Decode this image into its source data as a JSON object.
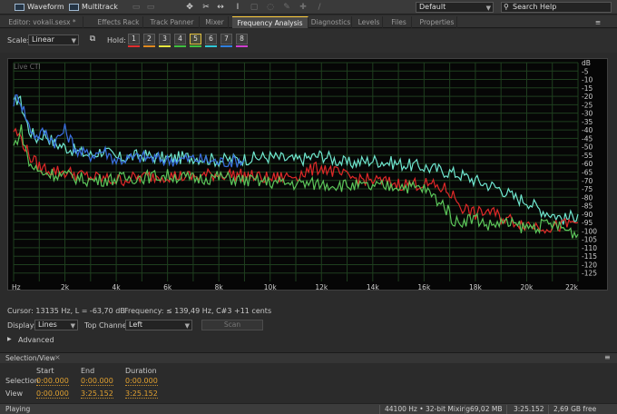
{
  "toolbar": {
    "waveform_label": "Waveform",
    "multitrack_label": "Multitrack",
    "workspace_value": "Default",
    "search_placeholder": "Search Help"
  },
  "tabs": [
    {
      "label": "Editor: vokali.sesx *"
    },
    {
      "label": "Effects Rack"
    },
    {
      "label": "Track Panner"
    },
    {
      "label": "Mixer"
    },
    {
      "label": "Frequency Analysis"
    },
    {
      "label": "Diagnostics"
    },
    {
      "label": "Levels"
    },
    {
      "label": "Files"
    },
    {
      "label": "Properties"
    }
  ],
  "controls": {
    "scale_label": "Scale:",
    "scale_value": "Linear",
    "hold_label": "Hold:",
    "holds": [
      {
        "label": "1",
        "color": "#e03030"
      },
      {
        "label": "2",
        "color": "#e08a20"
      },
      {
        "label": "3",
        "color": "#e8e840"
      },
      {
        "label": "4",
        "color": "#40c040"
      },
      {
        "label": "5",
        "color": "#40c040"
      },
      {
        "label": "6",
        "color": "#30c8d8"
      },
      {
        "label": "7",
        "color": "#3080e0"
      },
      {
        "label": "8",
        "color": "#d040d0"
      }
    ]
  },
  "chart_data": {
    "type": "line",
    "title": "Live CTI",
    "x_unit": "Hz",
    "xlim": [
      0,
      22000
    ],
    "x_ticks": [
      "Hz",
      "2k",
      "4k",
      "6k",
      "8k",
      "10k",
      "12k",
      "14k",
      "16k",
      "18k",
      "20k",
      "22k"
    ],
    "y_unit": "dB",
    "ylim": [
      -130,
      0
    ],
    "y_ticks": [
      "dB",
      "-5",
      "-10",
      "-15",
      "-20",
      "-25",
      "-30",
      "-35",
      "-40",
      "-45",
      "-50",
      "-55",
      "-60",
      "-65",
      "-70",
      "-75",
      "-80",
      "-85",
      "-90",
      "-95",
      "-100",
      "-105",
      "-110",
      "-115",
      "-120",
      "-125"
    ],
    "series": [
      {
        "color": "#6fe6cf",
        "x": [
          0,
          200,
          400,
          600,
          900,
          1200,
          1600,
          2000,
          2500,
          3000,
          3500,
          4000,
          5000,
          6000,
          7000,
          8000,
          9000,
          10000,
          11000,
          12000,
          13000,
          14000,
          15000,
          16000,
          17000,
          17500,
          18000,
          19000,
          19500,
          20000,
          20500,
          21000,
          21500,
          22000
        ],
        "y": [
          -25,
          -20,
          -30,
          -40,
          -45,
          -42,
          -48,
          -50,
          -53,
          -55,
          -52,
          -57,
          -55,
          -57,
          -56,
          -58,
          -57,
          -56,
          -58,
          -55,
          -60,
          -58,
          -60,
          -62,
          -65,
          -67,
          -70,
          -75,
          -80,
          -82,
          -87,
          -90,
          -93,
          -90
        ]
      },
      {
        "color": "#3a6fe0",
        "x": [
          0,
          200,
          400,
          600,
          900,
          1200,
          1600,
          2000,
          2500,
          3000,
          3500,
          4000,
          5000,
          6000,
          7000,
          8000,
          9000
        ],
        "y": [
          -23,
          -20,
          -28,
          -38,
          -44,
          -41,
          -47,
          -40,
          -53,
          -55,
          -52,
          -58,
          -56,
          -58,
          -57,
          -59,
          -58
        ]
      },
      {
        "color": "#e02828",
        "x": [
          0,
          300,
          600,
          1000,
          1500,
          2000,
          3000,
          4000,
          5000,
          6000,
          7000,
          8000,
          9000,
          10000,
          11000,
          12000,
          13000,
          14000,
          15000,
          16000,
          16800,
          17200,
          17500,
          18000,
          18500,
          19000,
          20000,
          21000,
          22000
        ],
        "y": [
          -40,
          -45,
          -55,
          -62,
          -64,
          -65,
          -68,
          -70,
          -68,
          -67,
          -68,
          -66,
          -67,
          -69,
          -67,
          -62,
          -68,
          -70,
          -72,
          -72,
          -75,
          -80,
          -86,
          -90,
          -88,
          -92,
          -96,
          -98,
          -95
        ]
      },
      {
        "color": "#5cc65a",
        "x": [
          0,
          300,
          600,
          1000,
          1500,
          2000,
          3000,
          4000,
          5000,
          6000,
          7000,
          8000,
          9000,
          10000,
          11000,
          12000,
          13000,
          14000,
          15000,
          16000,
          16800,
          17200,
          18000,
          18500,
          19000,
          20000,
          21000,
          22000
        ],
        "y": [
          -50,
          -40,
          -60,
          -65,
          -66,
          -67,
          -70,
          -69,
          -68,
          -67,
          -69,
          -68,
          -70,
          -71,
          -72,
          -72,
          -73,
          -74,
          -73,
          -75,
          -85,
          -95,
          -92,
          -97,
          -95,
          -98,
          -96,
          -102
        ]
      }
    ]
  },
  "status": {
    "cursor_text": "Cursor: 13135 Hz, L = -63,70 dB",
    "frequency_text": "Frequency: ≤ 139,49 Hz, C#3 +11 cents",
    "display_label": "Display:",
    "display_value": "Lines",
    "top_channel_label": "Top Channel:",
    "top_channel_value": "Left",
    "scan_label": "Scan",
    "advanced_label": "Advanced"
  },
  "selview": {
    "title": "Selection/View",
    "col_start": "Start",
    "col_end": "End",
    "col_duration": "Duration",
    "row_selection": "Selection",
    "row_view": "View",
    "sel_start": "0:00.000",
    "sel_end": "0:00.000",
    "sel_duration": "0:00.000",
    "view_start": "0:00.000",
    "view_end": "3:25.152",
    "view_duration": "3:25.152"
  },
  "statusbar": {
    "state": "Playing",
    "format": "44100 Hz • 32-bit Mixing",
    "memory": "69,02 MB",
    "duration": "3:25.152",
    "disk": "2,69 GB free"
  }
}
